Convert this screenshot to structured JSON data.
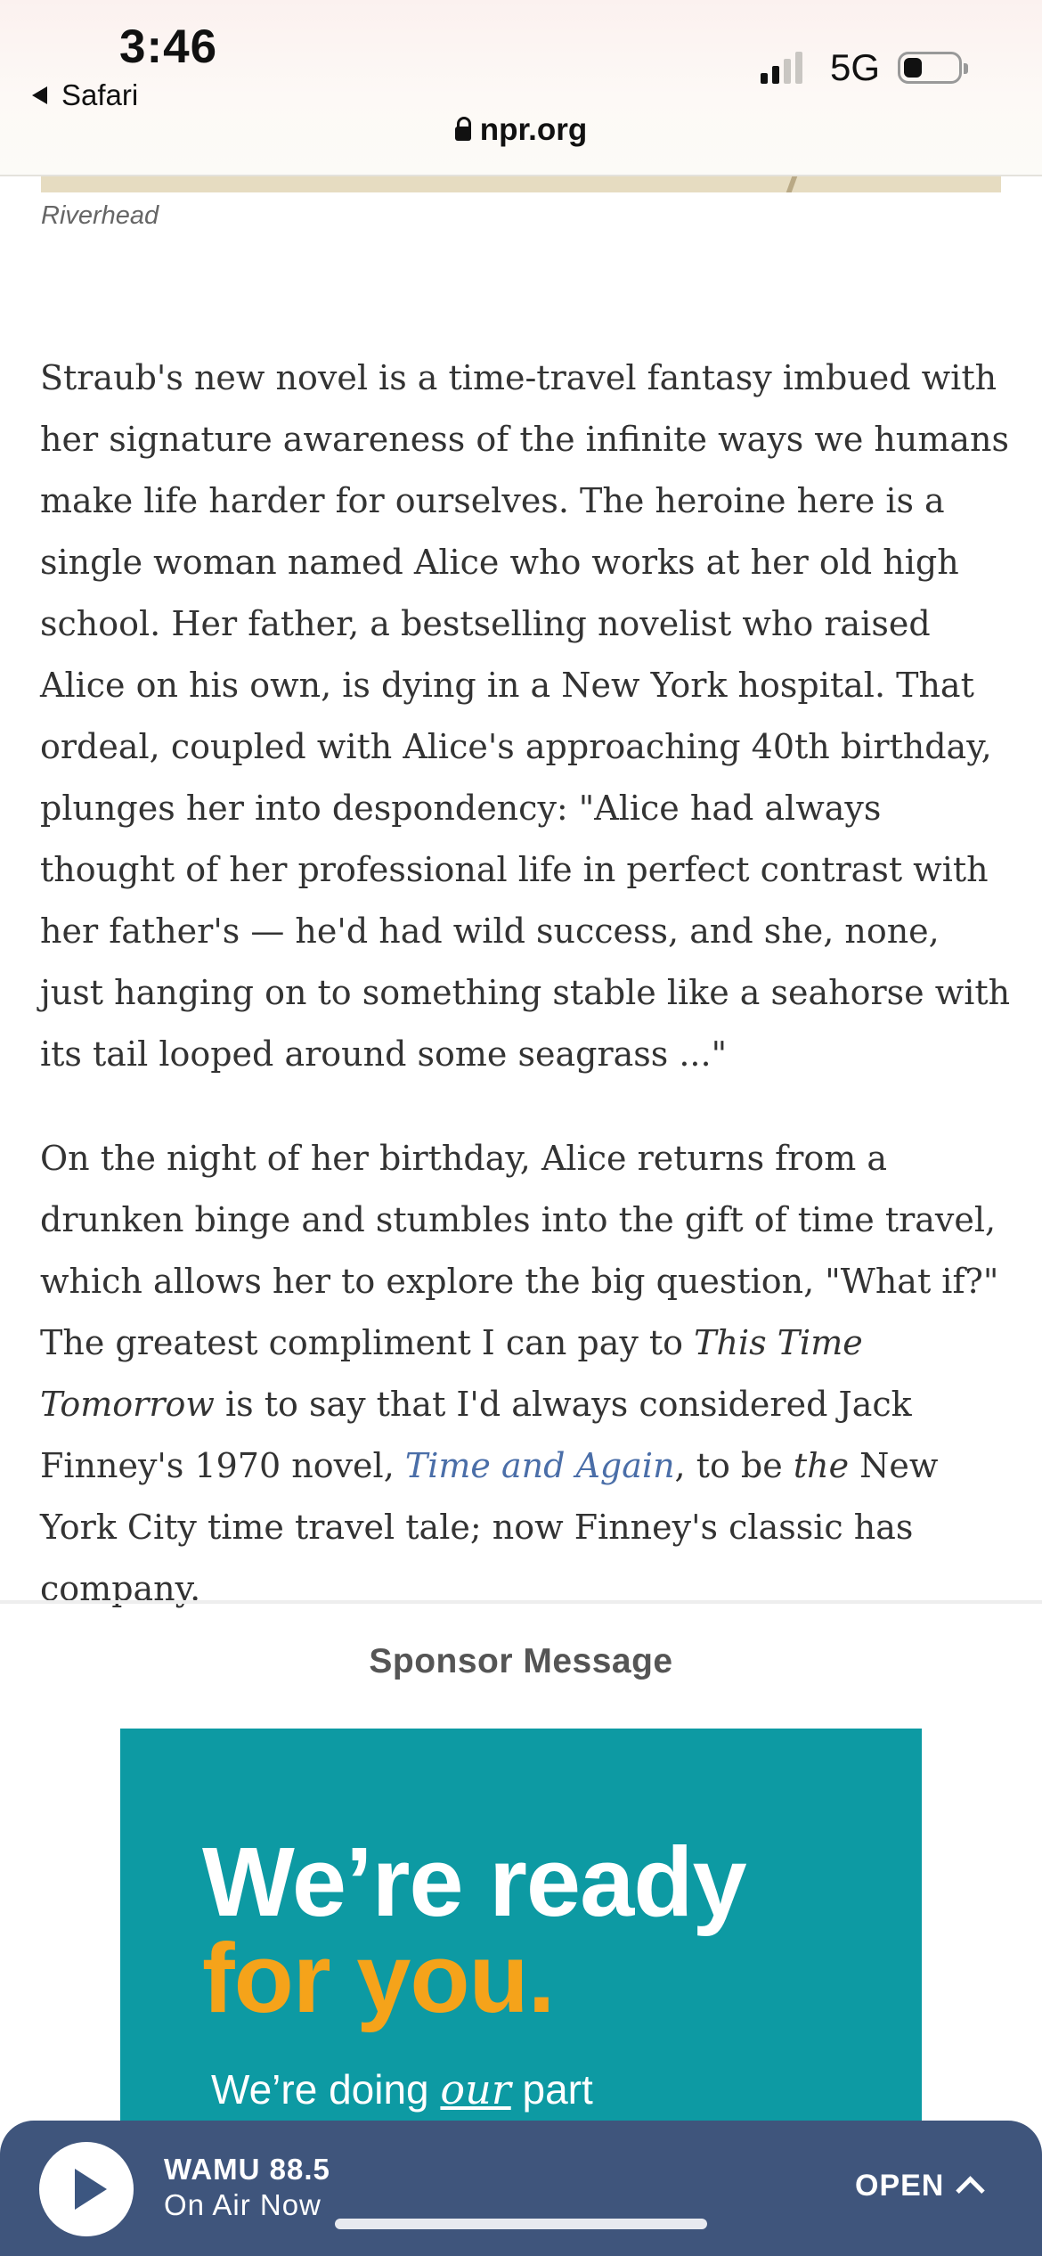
{
  "status": {
    "time": "3:46",
    "back_label": "Safari",
    "network": "5G",
    "url": "npr.org"
  },
  "photo_credit": "Riverhead",
  "article": {
    "p1": "Straub's new novel is a time-travel fantasy imbued with her signature awareness of the infinite ways we humans make life harder for ourselves. The heroine here is a single woman named Alice who works at her old high school. Her father, a bestselling novelist who raised Alice on his own, is dying in a New York hospital. That ordeal, coupled with Alice's approaching 40th birthday, plunges her into despondency: \"Alice had always thought of her professional life in perfect contrast with her father's — he'd had wild success, and she, none, just hanging on to something stable like a seahorse with its tail looped around some seagrass ...\"",
    "p2_a": "On the night of her birthday, Alice returns from a drunken binge and stumbles into the gift of time travel, which allows her to explore the big question, \"What if?\" The greatest compliment I can pay to ",
    "p2_title": "This Time Tomorrow",
    "p2_b": " is to say that I'd always considered Jack Finney's 1970 novel, ",
    "p2_link": "Time and Again",
    "p2_c": ", to be ",
    "p2_the": "the",
    "p2_d": " New York City time travel tale; now Finney's classic has company."
  },
  "sponsor": {
    "label": "Sponsor Message",
    "ad_line1": "We’re ready",
    "ad_line2": "for you.",
    "ad_line3_a": "We’re doing ",
    "ad_line3_our": "our",
    "ad_line3_b": " part"
  },
  "player": {
    "station": "WAMU 88.5",
    "status": "On Air Now",
    "open_label": "OPEN"
  },
  "colors": {
    "link": "#4a6ea8",
    "player_bg": "#3f557c",
    "ad_bg": "#0d9aa3",
    "ad_accent": "#f5a31a"
  }
}
